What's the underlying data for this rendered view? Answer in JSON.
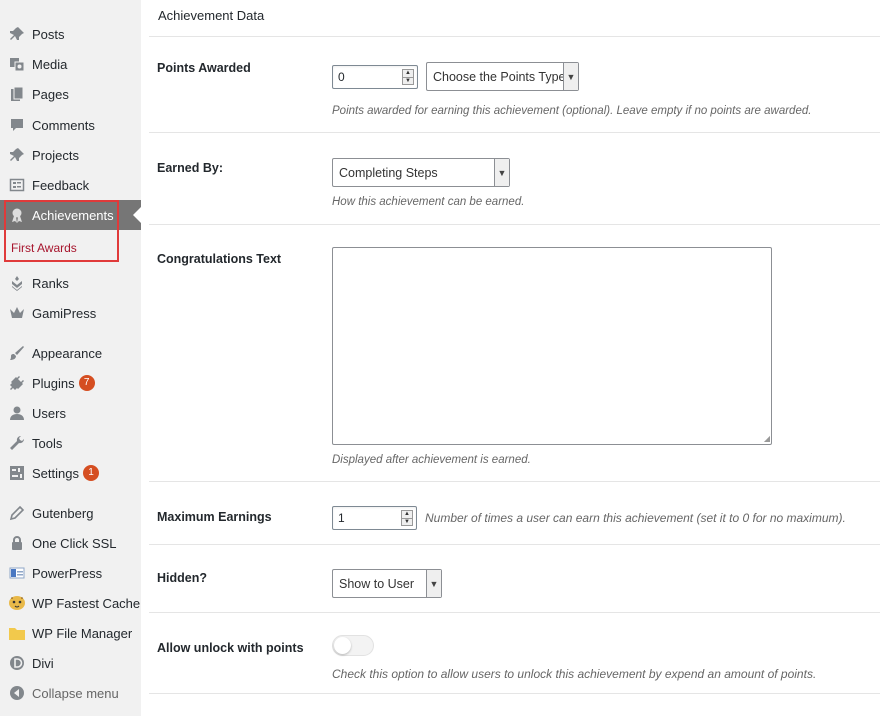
{
  "sidebar": {
    "items": [
      {
        "label": "Posts",
        "icon": "pushpin-icon"
      },
      {
        "label": "Media",
        "icon": "media-icon"
      },
      {
        "label": "Pages",
        "icon": "pages-icon"
      },
      {
        "label": "Comments",
        "icon": "comment-icon"
      },
      {
        "label": "Projects",
        "icon": "pushpin-icon"
      },
      {
        "label": "Feedback",
        "icon": "feedback-icon"
      },
      {
        "label": "Achievements",
        "icon": "award-icon"
      },
      {
        "label": "Ranks",
        "icon": "ranks-icon"
      },
      {
        "label": "GamiPress",
        "icon": "crown-icon"
      },
      {
        "label": "Appearance",
        "icon": "brush-icon"
      },
      {
        "label": "Plugins",
        "icon": "plug-icon",
        "badge": "7"
      },
      {
        "label": "Users",
        "icon": "user-icon"
      },
      {
        "label": "Tools",
        "icon": "wrench-icon"
      },
      {
        "label": "Settings",
        "icon": "settings-icon",
        "badge": "1"
      },
      {
        "label": "Gutenberg",
        "icon": "pencil-icon"
      },
      {
        "label": "One Click SSL",
        "icon": "lock-icon"
      },
      {
        "label": "PowerPress",
        "icon": "powerpress-icon"
      },
      {
        "label": "WP Fastest Cache",
        "icon": "cheetah-icon"
      },
      {
        "label": "WP File Manager",
        "icon": "folder-icon"
      },
      {
        "label": "Divi",
        "icon": "divi-icon"
      },
      {
        "label": "Collapse menu",
        "icon": "collapse-icon"
      }
    ],
    "submenu": {
      "label": "First Awards"
    }
  },
  "main": {
    "box_title": "Achievement Data",
    "points_awarded": {
      "label": "Points Awarded",
      "value": "0",
      "type_select": "Choose the Points Type",
      "description": "Points awarded for earning this achievement (optional). Leave empty if no points are awarded."
    },
    "earned_by": {
      "label": "Earned By:",
      "value": "Completing Steps",
      "description": "How this achievement can be earned."
    },
    "congrats": {
      "label": "Congratulations Text",
      "value": "",
      "description": "Displayed after achievement is earned."
    },
    "max_earnings": {
      "label": "Maximum Earnings",
      "value": "1",
      "description": "Number of times a user can earn this achievement (set it to 0 for no maximum)."
    },
    "hidden": {
      "label": "Hidden?",
      "value": "Show to User"
    },
    "unlock": {
      "label": "Allow unlock with points",
      "description": "Check this option to allow users to unlock this achievement by expend an amount of points."
    }
  }
}
